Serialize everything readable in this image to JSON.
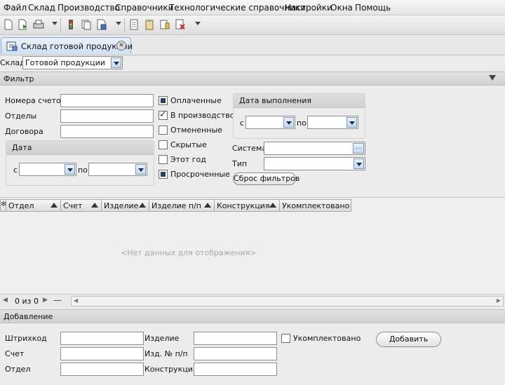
{
  "menu": [
    "Файл",
    "Склад",
    "Производство",
    "Справочники",
    "Технологические справочники",
    "Настройки",
    "Окна",
    "Помощь"
  ],
  "tab": {
    "label": "Склад готовой продукции"
  },
  "warehouse": {
    "label": "Склад",
    "value": "Готовой продукции"
  },
  "filter": {
    "title": "Фильтр",
    "fields": [
      "Номера счетов",
      "Отделы",
      "Договора"
    ],
    "date_group": {
      "title": "Дата",
      "from": "с",
      "to": "по"
    },
    "checkboxes": [
      {
        "label": "Оплаченные",
        "state": "partial"
      },
      {
        "label": "В производство",
        "state": "checked"
      },
      {
        "label": "Отмененные",
        "state": "unchecked"
      },
      {
        "label": "Скрытые",
        "state": "unchecked"
      },
      {
        "label": "Этот год",
        "state": "unchecked"
      },
      {
        "label": "Просроченные",
        "state": "partial"
      }
    ],
    "exec_date_group": {
      "title": "Дата выполнения",
      "from": "с",
      "to": "по"
    },
    "system_label": "Система",
    "system_btn": "...",
    "type_label": "Тип",
    "reset_button": "Сброс фильтров"
  },
  "grid": {
    "columns": [
      "Отдел",
      "Счет",
      "Изделие",
      "Изделие п/п",
      "Конструкция",
      "Укомплектовано"
    ],
    "empty_text": "<Нет данных для отображения>",
    "pager_text": "0 из 0"
  },
  "add": {
    "title": "Добавление",
    "barcode_label": "Штрихкод",
    "invoice_label": "Счет",
    "dept_label": "Отдел",
    "product_label": "Изделие",
    "product_no_label": "Изд. № п/п",
    "construction_label": "Конструкция",
    "complete_label": "Укомплектовано",
    "add_button": "Добавить"
  }
}
